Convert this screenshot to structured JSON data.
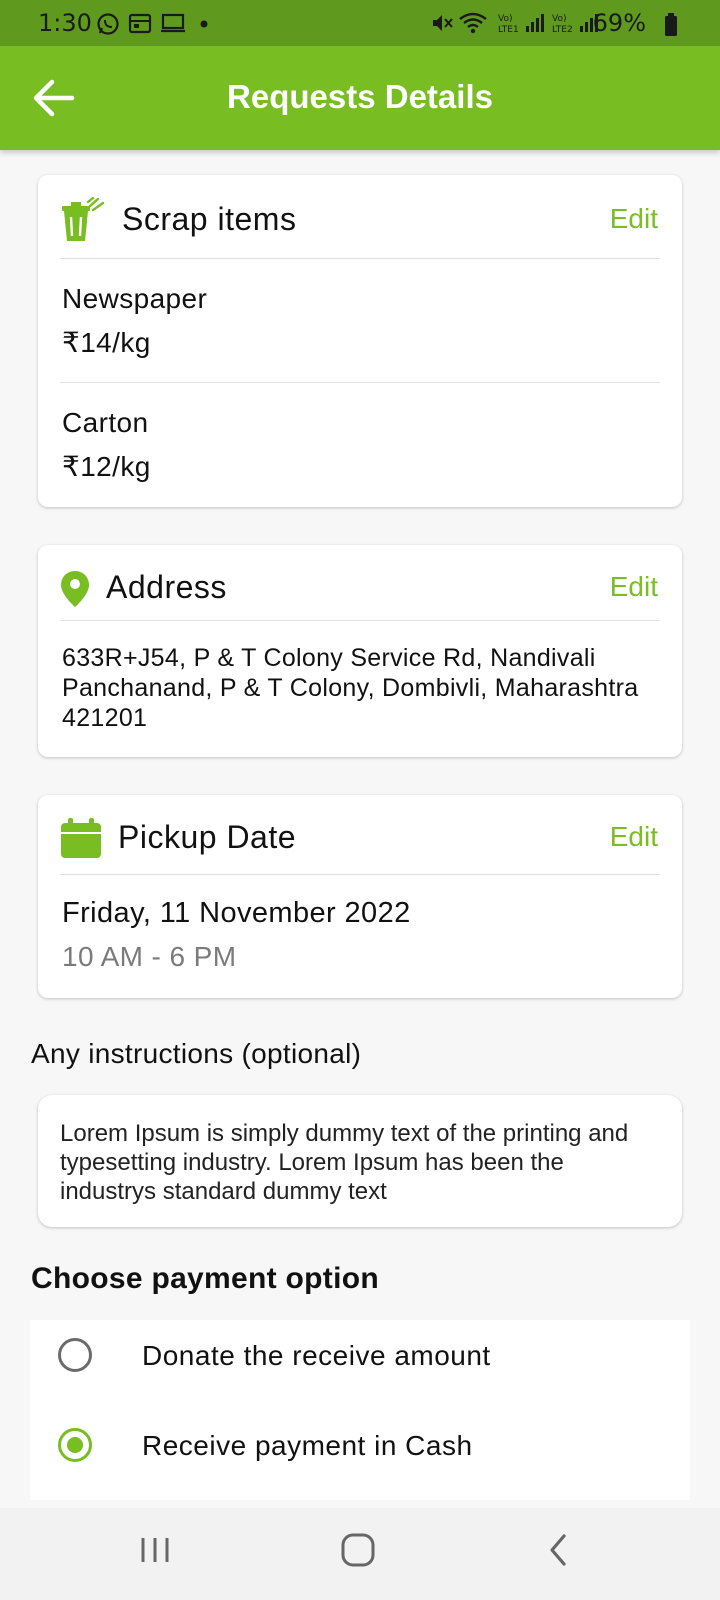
{
  "status_bar": {
    "time": "1:30",
    "battery": "69%",
    "icons": [
      "whatsapp-icon",
      "calendar-icon",
      "screen-icon",
      "dot-icon",
      "mute-icon",
      "wifi-icon",
      "signal-lte1-icon",
      "signal-lte2-icon",
      "battery-icon"
    ]
  },
  "app_bar": {
    "title": "Requests Details",
    "back_icon": "arrow-left-icon"
  },
  "scrap_card": {
    "title": "Scrap items",
    "edit_label": "Edit",
    "icon": "trash-bin-icon",
    "items": [
      {
        "name": "Newspaper",
        "price": "₹14/kg"
      },
      {
        "name": "Carton",
        "price": "₹12/kg"
      }
    ]
  },
  "address_card": {
    "title": "Address",
    "edit_label": "Edit",
    "icon": "location-pin-icon",
    "address": "633R+J54, P & T Colony Service Rd, Nandivali Panchanand, P & T Colony, Dombivli, Maharashtra 421201"
  },
  "pickup_card": {
    "title": "Pickup Date",
    "edit_label": "Edit",
    "icon": "calendar-icon",
    "date": "Friday, 11 November 2022",
    "time_window": "10 AM - 6 PM"
  },
  "instructions": {
    "label": "Any instructions (optional)",
    "text": "Lorem Ipsum is simply dummy text of the printing and typesetting industry. Lorem Ipsum has been the industrys standard dummy text"
  },
  "payment": {
    "label": "Choose payment option",
    "options": [
      {
        "label": "Donate the receive amount",
        "selected": false
      },
      {
        "label": "Receive payment in Cash",
        "selected": true
      }
    ]
  },
  "colors": {
    "accent": "#78bd22",
    "status_bar": "#5f9a1f",
    "secondary_text": "#7b7b7b"
  },
  "nav_bar": {
    "icons": [
      "recent-apps-icon",
      "home-icon",
      "back-icon"
    ]
  }
}
